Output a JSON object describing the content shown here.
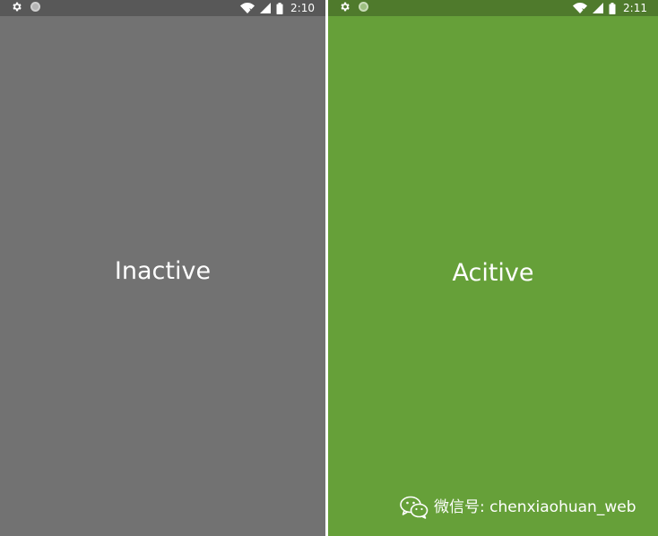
{
  "screens": [
    {
      "status_bar": {
        "time": "2:10",
        "background": "#585858"
      },
      "background": "#727272",
      "label": "Inactive"
    },
    {
      "status_bar": {
        "time": "2:11",
        "background": "#4f7a2c"
      },
      "background": "#66a039",
      "label": "Acitive"
    }
  ],
  "watermark": {
    "text": "微信号: chenxiaohuan_web",
    "icon": "wechat-icon"
  },
  "status_icons": [
    "gear-icon",
    "notification-dot-icon",
    "wifi-icon",
    "signal-icon",
    "battery-icon"
  ]
}
